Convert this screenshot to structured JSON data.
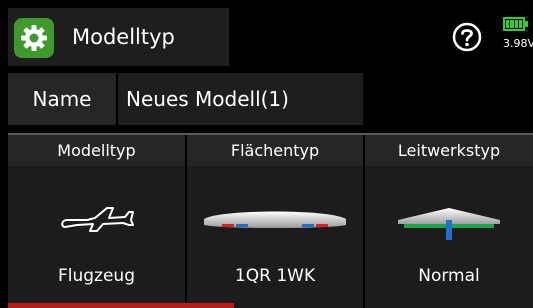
{
  "header": {
    "title": "Modelltyp",
    "help_icon": "question-circle-icon",
    "app_icon": "gear-icon",
    "battery_voltage": "3.98V"
  },
  "name_row": {
    "label": "Name",
    "value": "Neues Modell(1)"
  },
  "columns": [
    {
      "header": "Modelltyp",
      "value": "Flugzeug",
      "icon": "airplane-icon"
    },
    {
      "header": "Flächentyp",
      "value": "1QR 1WK",
      "icon": "wing-icon"
    },
    {
      "header": "Leitwerkstyp",
      "value": "Normal",
      "icon": "tail-icon"
    }
  ],
  "colors": {
    "accent_green": "#3f9a2c",
    "battery_green": "#2dcf2d",
    "selection_red": "#b81c1c",
    "aileron_red": "#e02020",
    "flap_blue": "#1e6fd0",
    "elevator_green": "#1aa64a"
  }
}
